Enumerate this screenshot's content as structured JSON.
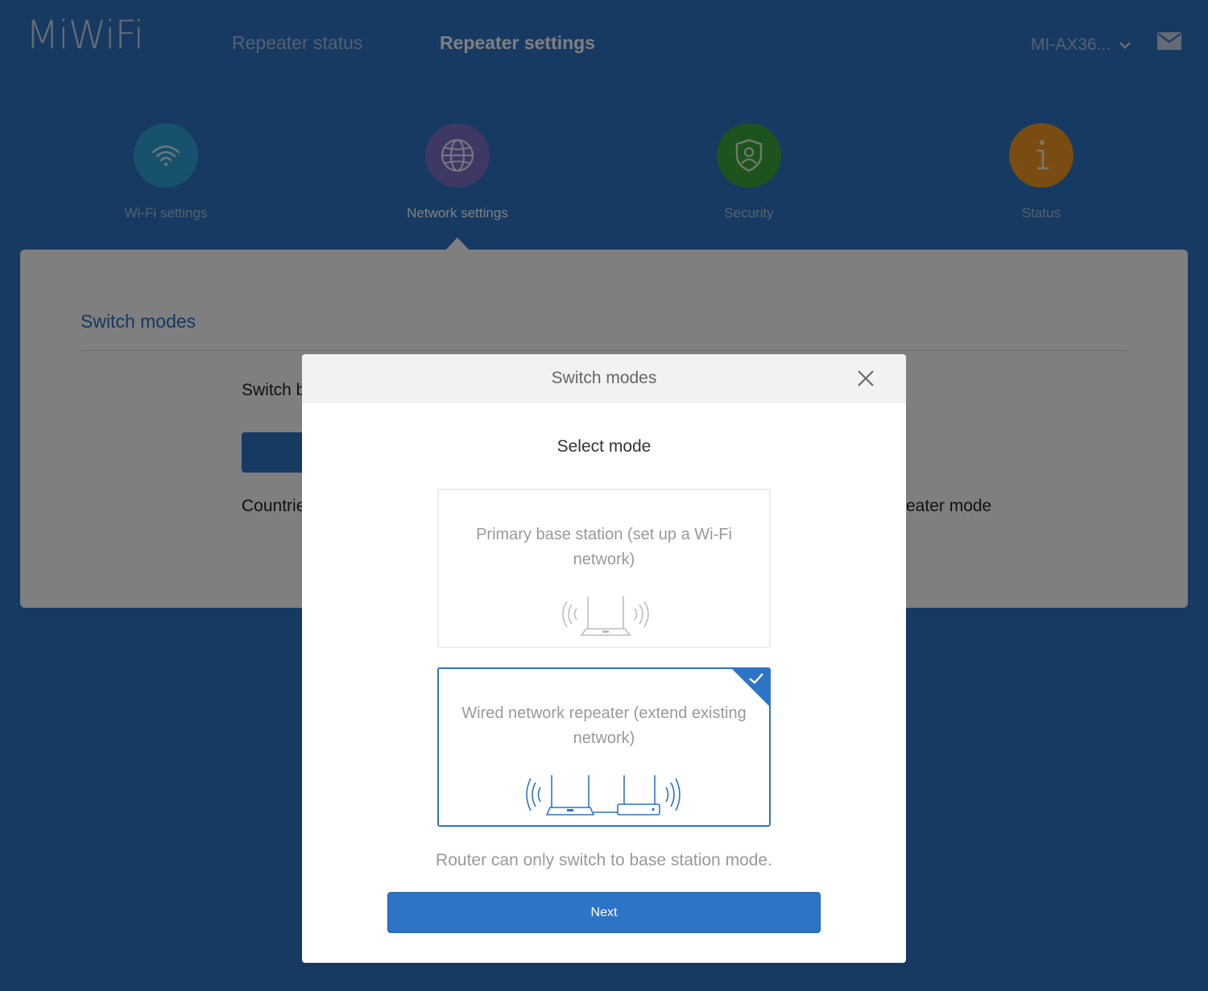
{
  "header": {
    "logo": "MiWiFi",
    "nav": [
      {
        "label": "Repeater status"
      },
      {
        "label": "Repeater settings"
      }
    ],
    "device_name": "MI-AX36...",
    "mail_icon": "mail-icon"
  },
  "functions": [
    {
      "label": "Wi-Fi settings",
      "icon": "wifi-icon",
      "color": "#2fa3d6"
    },
    {
      "label": "Network settings",
      "icon": "globe-icon",
      "color": "#7b73c9"
    },
    {
      "label": "Security",
      "icon": "shield-icon",
      "color": "#3aa83a"
    },
    {
      "label": "Status",
      "icon": "info-icon",
      "color": "#f29a22"
    }
  ],
  "card": {
    "title": "Switch modes",
    "switch_text": "Switch b",
    "countries_text": "Countrie",
    "repeater_text": "eater mode"
  },
  "modal": {
    "title": "Switch modes",
    "subtitle": "Select mode",
    "options": [
      {
        "label": "Primary base station (set up a Wi-Fi network)",
        "selected": false
      },
      {
        "label": "Wired network repeater (extend existing network)",
        "selected": true
      }
    ],
    "note": "Router can only switch to base station mode.",
    "next_label": "Next"
  },
  "colors": {
    "accent": "#2e74c6",
    "muted_text": "#999999"
  }
}
